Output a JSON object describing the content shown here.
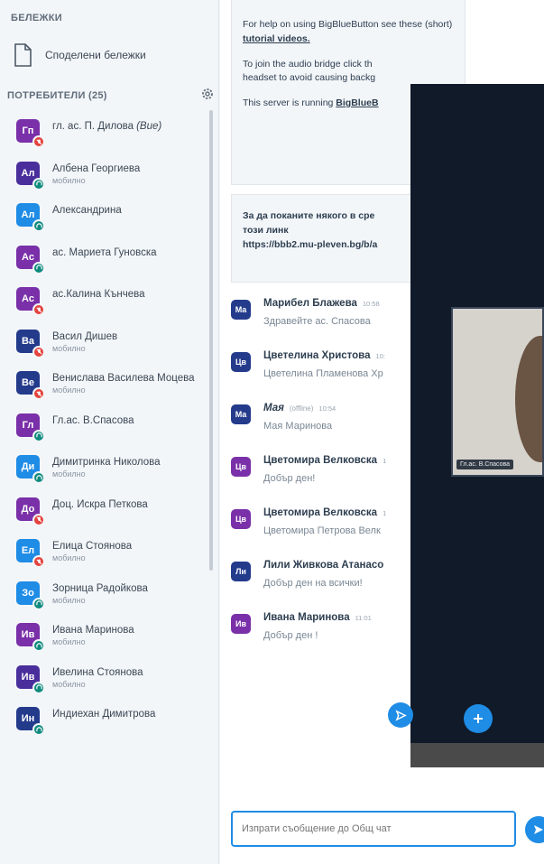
{
  "notes": {
    "section_title": "БЕЛЕЖКИ",
    "shared_notes_label": "Споделени бележки"
  },
  "users": {
    "section_title": "ПОТРЕБИТЕЛИ (25)",
    "items": [
      {
        "initials": "Гп",
        "name": "гл. ас. П. Дилова",
        "status": "(Вие)",
        "sub": "",
        "color": "#7a30a8",
        "mic": "muted"
      },
      {
        "initials": "Ал",
        "name": "Албена Георгиева",
        "status": "",
        "sub": "мобилно",
        "color": "#4a2f9c",
        "mic": "listen"
      },
      {
        "initials": "Ал",
        "name": "Александрина",
        "status": "",
        "sub": "",
        "color": "#1f8ce6",
        "mic": "listen"
      },
      {
        "initials": "Ас",
        "name": "ас. Мариета Гуновска",
        "status": "",
        "sub": "",
        "color": "#7a30a8",
        "mic": "listen"
      },
      {
        "initials": "Ас",
        "name": "ас.Калина Кънчева",
        "status": "",
        "sub": "",
        "color": "#7a30a8",
        "mic": "muted"
      },
      {
        "initials": "Ва",
        "name": "Васил Дишев",
        "status": "",
        "sub": "мобилно",
        "color": "#243b8c",
        "mic": "muted"
      },
      {
        "initials": "Ве",
        "name": "Венислава Василева Моцева",
        "status": "",
        "sub": "мобилно",
        "color": "#243b8c",
        "mic": "muted"
      },
      {
        "initials": "Гл",
        "name": "Гл.ас. В.Спасова",
        "status": "",
        "sub": "",
        "color": "#7a30a8",
        "mic": "listen"
      },
      {
        "initials": "Ди",
        "name": "Димитринка Николова",
        "status": "",
        "sub": "мобилно",
        "color": "#1f8ce6",
        "mic": "listen"
      },
      {
        "initials": "До",
        "name": "Доц. Искра Петкова",
        "status": "",
        "sub": "",
        "color": "#7a30a8",
        "mic": "muted"
      },
      {
        "initials": "Ел",
        "name": "Елица Стоянова",
        "status": "",
        "sub": "мобилно",
        "color": "#1f8ce6",
        "mic": "muted"
      },
      {
        "initials": "Зо",
        "name": "Зорница Радойкова",
        "status": "",
        "sub": "мобилно",
        "color": "#1f8ce6",
        "mic": "listen"
      },
      {
        "initials": "Ив",
        "name": "Ивана Маринова",
        "status": "",
        "sub": "мобилно",
        "color": "#7a30a8",
        "mic": "listen"
      },
      {
        "initials": "Ив",
        "name": "Ивелина Стоянова",
        "status": "",
        "sub": "мобилно",
        "color": "#4a2f9c",
        "mic": "listen"
      },
      {
        "initials": "Ин",
        "name": "Индиехан Димитрова",
        "status": "",
        "sub": "",
        "color": "#243b8c",
        "mic": "listen"
      }
    ]
  },
  "welcome": {
    "help_text": "For help on using BigBlueButton see these (short)",
    "help_link": "tutorial videos.",
    "audio_text_1": "To join the audio bridge click th",
    "audio_text_2": "headset to avoid causing backg",
    "server_text": "This server is running ",
    "server_link": "BigBlueB"
  },
  "invite": {
    "line1": "За да поканите някого в сре",
    "line2": "този линк",
    "link": "https://bbb2.mu-pleven.bg/b/a"
  },
  "messages": [
    {
      "initials": "Ма",
      "color": "#243b8c",
      "name": "Марибел Блажева",
      "status": "",
      "time": "10:58",
      "text": "Здравейте ас. Спасова"
    },
    {
      "initials": "Цв",
      "color": "#243b8c",
      "name": "Цветелина Христова",
      "status": "",
      "time": "10:",
      "text": "Цветелина Пламенова Хр"
    },
    {
      "initials": "Ма",
      "color": "#243b8c",
      "name": "Мая",
      "status": "(offline)",
      "time": "10:54",
      "text": "Мая Маринова"
    },
    {
      "initials": "Цв",
      "color": "#7a30a8",
      "name": "Цветомира Велковска",
      "status": "",
      "time": "1",
      "text": "Добър ден!"
    },
    {
      "initials": "Цв",
      "color": "#7a30a8",
      "name": "Цветомира Велковска",
      "status": "",
      "time": "1",
      "text": "Цветомира Петрова Велк"
    },
    {
      "initials": "Ли",
      "color": "#243b8c",
      "name": "Лили Живкова Атанасо",
      "status": "",
      "time": "",
      "text": "Добър ден на всички!"
    },
    {
      "initials": "Ив",
      "color": "#7a30a8",
      "name": "Ивана Маринова",
      "status": "",
      "time": "11:01",
      "text": "Добър ден !"
    }
  ],
  "chat": {
    "input_placeholder": "Изпрати съобщение до Общ чат"
  },
  "video": {
    "label": "Гл.ас. В.Спасова"
  },
  "colors": {
    "accent": "#1f8ce6",
    "muted_red": "#e4423c",
    "listen_teal": "#0f8a7e",
    "presentation_bg": "#101a29"
  }
}
